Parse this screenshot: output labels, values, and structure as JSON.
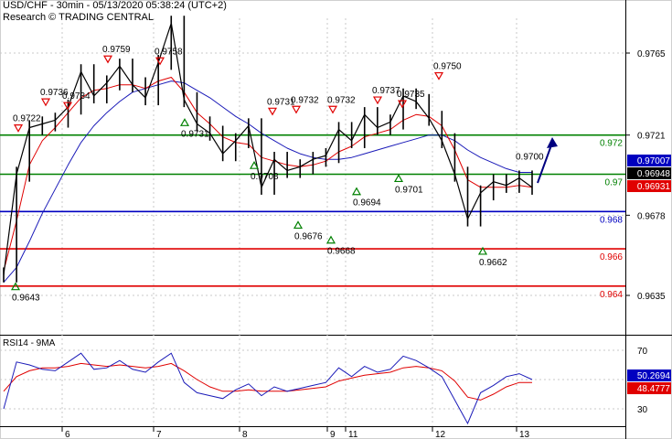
{
  "header": {
    "line1": "USD/CHF - 30min - 05/13/2020 05:38:24 (UTC+2)",
    "line2": "Research © TRADING CENTRAL"
  },
  "rsi_panel": {
    "label": "RSI14 - 9MA",
    "ticks": [
      "70",
      "50",
      "30"
    ],
    "rsi_value": "50.2694",
    "ma_value": "48.4777"
  },
  "colors": {
    "price": "#000000",
    "ma_red": "#e00000",
    "ma_blue": "#1a1ab8",
    "support_resistance_green": "#008000",
    "pivot_blue": "#0000c0",
    "support_red": "#e00000",
    "arrow": "#000080",
    "peak_marker": "#e00000",
    "trough_marker": "#008000",
    "badge_black": "#000000",
    "badge_blue": "#0000c0",
    "badge_red": "#e00000"
  },
  "chart_data": [
    {
      "type": "line",
      "title": "USD/CHF - 30min - 05/13/2020 05:38:24 (UTC+2)",
      "x_tick_labels": [
        "6",
        "7",
        "8",
        "9",
        "11",
        "12",
        "13"
      ],
      "y_tick_labels": [
        "0.9765",
        "0.9721",
        "0.9678",
        "0.9635"
      ],
      "ylim": [
        0.9628,
        0.9798
      ],
      "levels": [
        {
          "value": 0.9721,
          "label": "0.972",
          "color": "#008000"
        },
        {
          "value": 0.97,
          "label": "0.97",
          "color": "#008000"
        },
        {
          "value": 0.968,
          "label": "0.968",
          "color": "#0000c0"
        },
        {
          "value": 0.966,
          "label": "0.966",
          "color": "#e00000"
        },
        {
          "value": 0.964,
          "label": "0.964",
          "color": "#e00000"
        }
      ],
      "price_badges": [
        {
          "value": "0.97007",
          "color": "#0000c0"
        },
        {
          "value": "0.96948",
          "color": "#000000"
        },
        {
          "value": "0.96931",
          "color": "#e00000"
        }
      ],
      "pivot_labels": [
        {
          "text": "0.9722",
          "price": 0.9722,
          "kind": "peak"
        },
        {
          "text": "0.9736",
          "price": 0.9736,
          "kind": "peak"
        },
        {
          "text": "0.9734",
          "price": 0.9734,
          "kind": "peak"
        },
        {
          "text": "0.9759",
          "price": 0.9759,
          "kind": "peak"
        },
        {
          "text": "0.9758",
          "price": 0.9758,
          "kind": "peak"
        },
        {
          "text": "0.9731",
          "price": 0.9731,
          "kind": "trough"
        },
        {
          "text": "0.9731",
          "price": 0.9731,
          "kind": "peak"
        },
        {
          "text": "0.9732",
          "price": 0.9732,
          "kind": "peak"
        },
        {
          "text": "0.9732",
          "price": 0.9732,
          "kind": "peak"
        },
        {
          "text": "0.9737",
          "price": 0.9737,
          "kind": "peak"
        },
        {
          "text": "0.9735",
          "price": 0.9735,
          "kind": "peak"
        },
        {
          "text": "0.9750",
          "price": 0.975,
          "kind": "peak"
        },
        {
          "text": "0.9708",
          "price": 0.9708,
          "kind": "trough"
        },
        {
          "text": "0.9694",
          "price": 0.9694,
          "kind": "trough"
        },
        {
          "text": "0.9701",
          "price": 0.9701,
          "kind": "trough"
        },
        {
          "text": "0.9676",
          "price": 0.9676,
          "kind": "trough"
        },
        {
          "text": "0.9668",
          "price": 0.9668,
          "kind": "trough"
        },
        {
          "text": "0.9662",
          "price": 0.9662,
          "kind": "trough"
        },
        {
          "text": "0.9643",
          "price": 0.9643,
          "kind": "trough"
        },
        {
          "text": "0.9700",
          "price": 0.97,
          "kind": "target"
        }
      ],
      "series": [
        {
          "name": "price",
          "y": [
            0.9646,
            0.97,
            0.9725,
            0.9727,
            0.9729,
            0.9736,
            0.9755,
            0.9742,
            0.9749,
            0.9758,
            0.9748,
            0.9741,
            0.976,
            0.9781,
            0.974,
            0.9727,
            0.9722,
            0.9711,
            0.9718,
            0.9726,
            0.9693,
            0.9708,
            0.9702,
            0.9704,
            0.9708,
            0.971,
            0.9724,
            0.9718,
            0.9732,
            0.9725,
            0.9728,
            0.9742,
            0.9739,
            0.973,
            0.9718,
            0.97,
            0.9676,
            0.969,
            0.9696,
            0.9694,
            0.9698,
            0.9693
          ]
        },
        {
          "name": "ma_fast",
          "y": [
            0.9648,
            0.9675,
            0.9705,
            0.9718,
            0.9725,
            0.9733,
            0.9741,
            0.9745,
            0.9746,
            0.9748,
            0.9748,
            0.9746,
            0.975,
            0.9752,
            0.9744,
            0.9733,
            0.9727,
            0.972,
            0.9717,
            0.9716,
            0.9709,
            0.9707,
            0.9705,
            0.9704,
            0.9705,
            0.9707,
            0.9712,
            0.9715,
            0.972,
            0.9722,
            0.9724,
            0.9729,
            0.9732,
            0.9731,
            0.9726,
            0.9713,
            0.9697,
            0.9693,
            0.9693,
            0.9693,
            0.9694,
            0.9693
          ]
        },
        {
          "name": "ma_slow",
          "y": [
            0.9642,
            0.965,
            0.9664,
            0.9679,
            0.9692,
            0.9705,
            0.9717,
            0.9726,
            0.9733,
            0.9739,
            0.9744,
            0.9746,
            0.9748,
            0.975,
            0.9749,
            0.9745,
            0.9741,
            0.9736,
            0.9731,
            0.9727,
            0.9722,
            0.9718,
            0.9714,
            0.9711,
            0.9709,
            0.9708,
            0.9708,
            0.9709,
            0.9711,
            0.9713,
            0.9715,
            0.9717,
            0.9719,
            0.9721,
            0.9721,
            0.9718,
            0.9713,
            0.9709,
            0.9706,
            0.9703,
            0.9701,
            0.9701
          ]
        },
        {
          "name": "rsi",
          "y": [
            30,
            62,
            60,
            57,
            56,
            62,
            68,
            57,
            58,
            63,
            57,
            55,
            62,
            68,
            48,
            41,
            39,
            37,
            43,
            47,
            39,
            45,
            42,
            44,
            46,
            48,
            58,
            52,
            59,
            55,
            57,
            66,
            63,
            58,
            52,
            36,
            20,
            41,
            46,
            52,
            54,
            50
          ]
        },
        {
          "name": "rsi_ma",
          "y": [
            42,
            52,
            56,
            58,
            58,
            59,
            61,
            60,
            59,
            60,
            59,
            58,
            59,
            61,
            56,
            50,
            45,
            42,
            42,
            43,
            42,
            42,
            42,
            43,
            44,
            45,
            49,
            51,
            53,
            54,
            55,
            58,
            59,
            58,
            56,
            49,
            38,
            36,
            40,
            45,
            48,
            48
          ]
        }
      ]
    }
  ]
}
